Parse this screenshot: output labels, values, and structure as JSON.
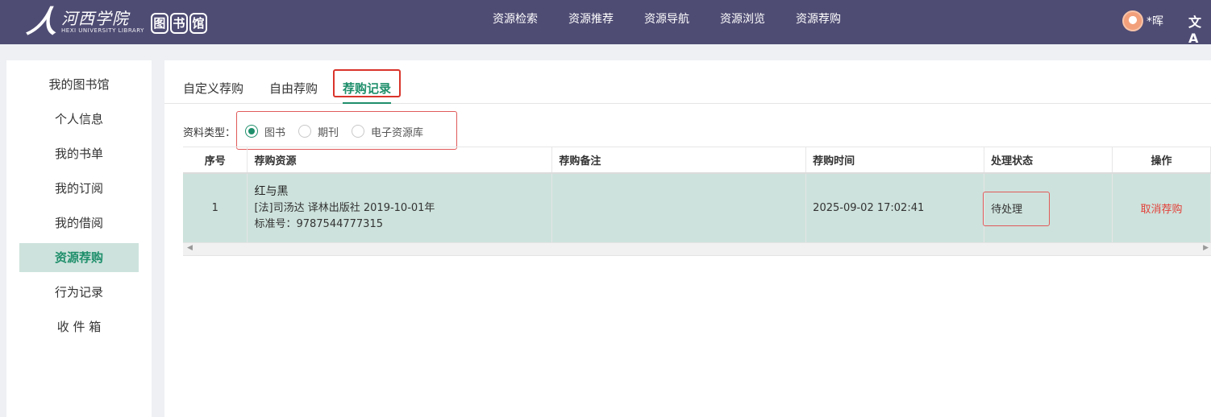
{
  "header": {
    "logo_mark": "人",
    "logo_cn": "河西学院",
    "logo_en": "HEXI UNIVERSITY LIBRARY",
    "logo_lib": [
      "图",
      "书",
      "馆"
    ],
    "nav": [
      "资源检索",
      "资源推荐",
      "资源导航",
      "资源浏览",
      "资源荐购"
    ],
    "user_name": "*晖",
    "translate_icon": "文A"
  },
  "sidebar": {
    "items": [
      "我的图书馆",
      "个人信息",
      "我的书单",
      "我的订阅",
      "我的借阅",
      "资源荐购",
      "行为记录",
      "收 件 箱"
    ],
    "active_index": 5
  },
  "tabs": {
    "items": [
      "自定义荐购",
      "自由荐购",
      "荐购记录"
    ],
    "active_index": 2
  },
  "filter": {
    "label": "资料类型：",
    "options": [
      "图书",
      "期刊",
      "电子资源库"
    ],
    "selected_index": 0
  },
  "table": {
    "columns": [
      "序号",
      "荐购资源",
      "荐购备注",
      "荐购时间",
      "处理状态",
      "操作"
    ],
    "rows": [
      {
        "no": "1",
        "title": "红与黑",
        "line1": "[法]司汤达 译林出版社 2019-10-01年",
        "line2": "标准号：9787544777315",
        "note": "",
        "time": "2025-09-02 17:02:41",
        "status": "待处理",
        "action": "取消荐购"
      }
    ]
  },
  "colors": {
    "header_bg": "#4f4c74",
    "accent": "#1f8f6b",
    "row_highlight": "#cde2dc",
    "danger": "#e2413a"
  }
}
